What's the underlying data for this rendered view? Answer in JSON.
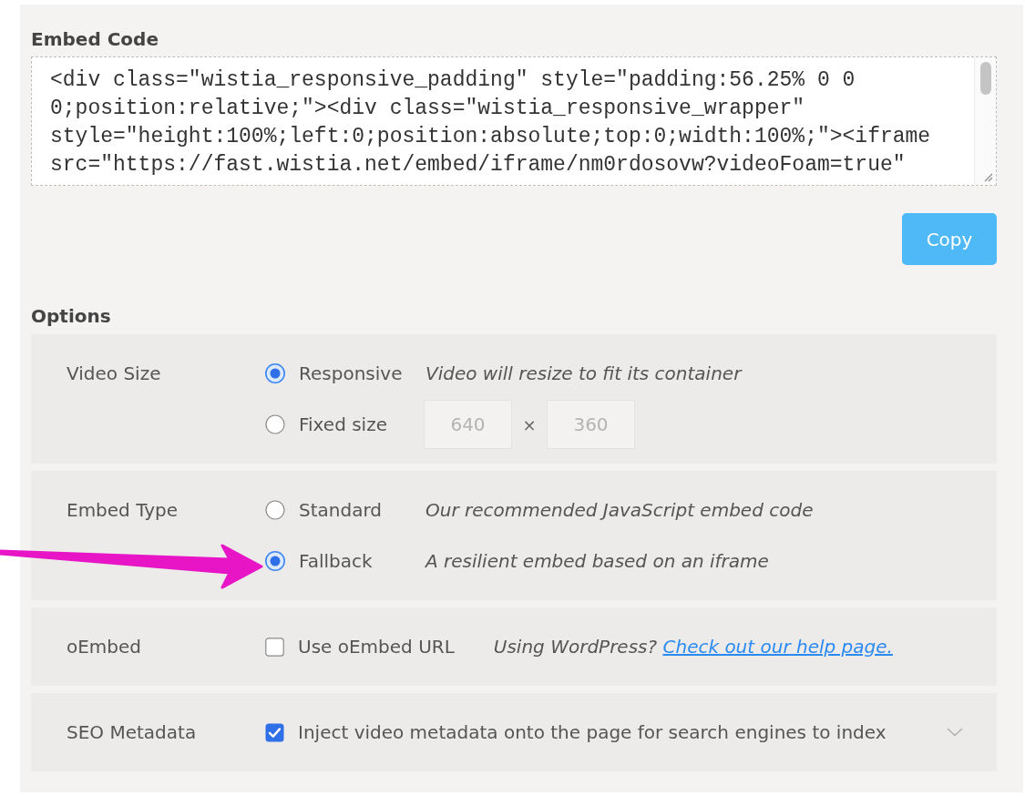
{
  "embed_code": {
    "heading": "Embed Code",
    "code": "<div class=\"wistia_responsive_padding\" style=\"padding:56.25% 0 0 0;position:relative;\"><div class=\"wistia_responsive_wrapper\" style=\"height:100%;left:0;position:absolute;top:0;width:100%;\"><iframe src=\"https://fast.wistia.net/embed/iframe/nm0rdosovw?videoFoam=true\"",
    "copy_button": "Copy"
  },
  "options": {
    "heading": "Options",
    "sections": [
      {
        "label": "Video Size",
        "kind": "radio",
        "choices": [
          {
            "label": "Responsive",
            "selected": true,
            "description": "Video will resize to fit its container"
          },
          {
            "label": "Fixed size",
            "selected": false,
            "size_fields": {
              "width_placeholder": "640",
              "separator": "×",
              "height_placeholder": "360"
            }
          }
        ]
      },
      {
        "label": "Embed Type",
        "kind": "radio",
        "choices": [
          {
            "label": "Standard",
            "selected": false,
            "description": "Our recommended JavaScript embed code"
          },
          {
            "label": "Fallback",
            "selected": true,
            "description": "A resilient embed based on an iframe"
          }
        ]
      },
      {
        "label": "oEmbed",
        "kind": "checkbox",
        "option": "Use oEmbed URL",
        "checked": false,
        "description": "Using WordPress?",
        "link": "Check out our help page."
      },
      {
        "label": "SEO Metadata",
        "kind": "checkbox",
        "option": "Inject video metadata onto the page for search engines to index",
        "checked": true,
        "expanded": false
      }
    ]
  }
}
